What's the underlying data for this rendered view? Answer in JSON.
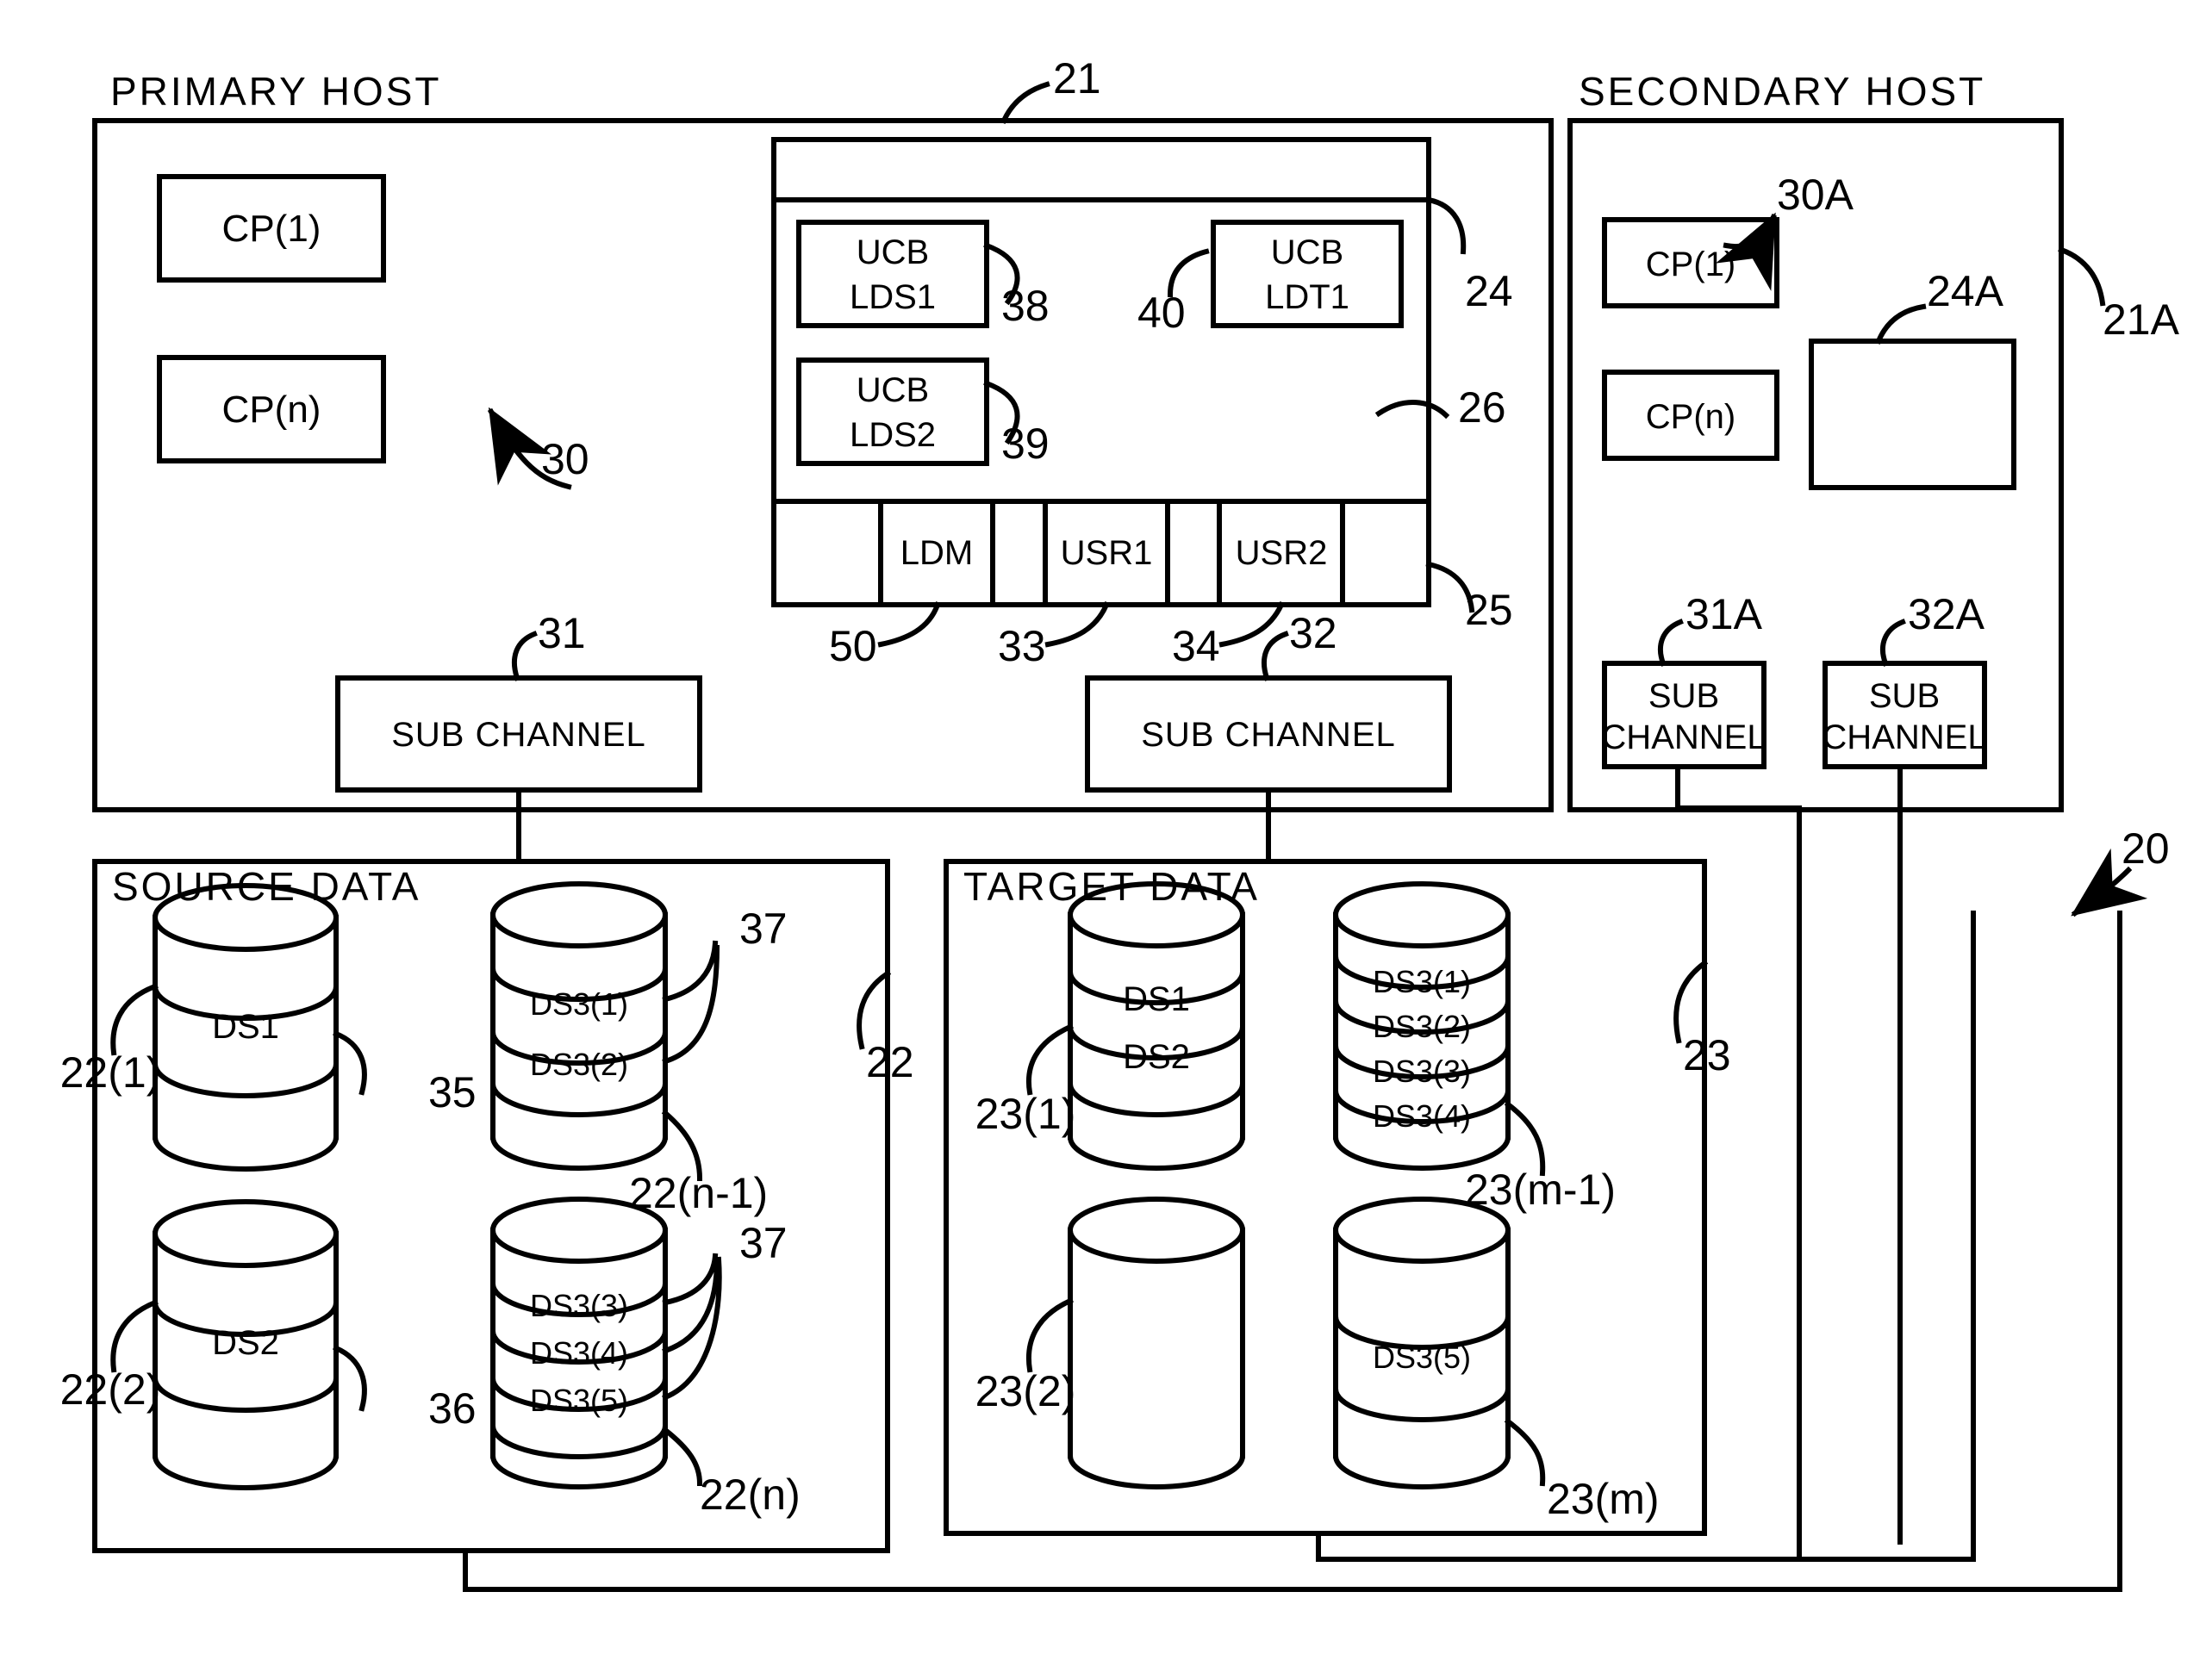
{
  "figure": {
    "type": "patent-block-diagram",
    "overall_ref": "20"
  },
  "primary_host": {
    "title": "PRIMARY HOST",
    "ref": "21",
    "cpu_group_ref": "30",
    "processors": [
      {
        "label": "CP(1)"
      },
      {
        "label": "CP(n)"
      }
    ],
    "memory": {
      "top_band_ref": "24",
      "middle_ref": "26",
      "bottom_band_ref": "25",
      "ucbs": [
        {
          "line1": "UCB",
          "line2": "LDS1",
          "ref": "38"
        },
        {
          "line1": "UCB",
          "line2": "LDS2",
          "ref": "39"
        },
        {
          "line1": "UCB",
          "line2": "LDT1",
          "ref": "40"
        }
      ],
      "programs": [
        {
          "label": "",
          "ref": ""
        },
        {
          "label": "LDM",
          "ref": "50"
        },
        {
          "label": "",
          "ref": ""
        },
        {
          "label": "USR1",
          "ref": "33"
        },
        {
          "label": "",
          "ref": ""
        },
        {
          "label": "USR2",
          "ref": "34"
        },
        {
          "label": "",
          "ref": ""
        }
      ]
    },
    "sub_channels": [
      {
        "line1": "SUB CHANNEL",
        "ref": "31"
      },
      {
        "line1": "SUB CHANNEL",
        "ref": "32"
      }
    ]
  },
  "secondary_host": {
    "title": "SECONDARY HOST",
    "ref": "21A",
    "cpu_group_ref": "30A",
    "processors": [
      {
        "label": "CP(1)"
      },
      {
        "label": "CP(n)"
      }
    ],
    "memory": {
      "ref": "24A"
    },
    "sub_channels": [
      {
        "line1": "SUB",
        "line2": "CHANNEL",
        "ref": "31A"
      },
      {
        "line1": "SUB",
        "line2": "CHANNEL",
        "ref": "32A"
      }
    ]
  },
  "source_data": {
    "title": "SOURCE DATA",
    "ref": "22",
    "devices": [
      {
        "ref": "22(1)",
        "ref_side": "left",
        "inner_ref": "35",
        "bands": 3,
        "labels": [
          {
            "band": 1,
            "text": "DS1"
          }
        ]
      },
      {
        "ref": "22(n-1)",
        "ref_side": "right",
        "inner_ref": "37",
        "bands": 3,
        "labels": [
          {
            "band": 0,
            "text": "DS3(1)"
          },
          {
            "band": 2,
            "text": "DS3(2)"
          }
        ]
      },
      {
        "ref": "22(2)",
        "ref_side": "left",
        "inner_ref": "36",
        "bands": 3,
        "labels": [
          {
            "band": 1,
            "text": "DS2"
          }
        ]
      },
      {
        "ref": "22(n)",
        "ref_side": "right",
        "inner_ref": "37",
        "bands": 4,
        "labels": [
          {
            "band": 1,
            "text": "DS3(3)"
          },
          {
            "band": 2,
            "text": "DS3(4)"
          },
          {
            "band": 3,
            "text": "DS3(5)"
          }
        ]
      }
    ]
  },
  "target_data": {
    "title": "TARGET DATA",
    "ref": "23",
    "devices": [
      {
        "ref": "23(1)",
        "ref_side": "left",
        "bands": 4,
        "labels": [
          {
            "band": 1,
            "text": "DS1"
          },
          {
            "band": 2,
            "text": "DS2"
          }
        ]
      },
      {
        "ref": "23(m-1)",
        "ref_side": "right",
        "bands": 5,
        "labels": [
          {
            "band": 1,
            "text": "DS3(1)"
          },
          {
            "band": 2,
            "text": "DS3(2)"
          },
          {
            "band": 3,
            "text": "DS3(3)"
          },
          {
            "band": 4,
            "text": "DS3(4)"
          }
        ]
      },
      {
        "ref": "23(2)",
        "ref_side": "left",
        "bands": 1,
        "labels": []
      },
      {
        "ref": "23(m)",
        "ref_side": "right",
        "bands": 3,
        "labels": [
          {
            "band": 1,
            "text": "DS3(5)"
          }
        ]
      }
    ]
  }
}
